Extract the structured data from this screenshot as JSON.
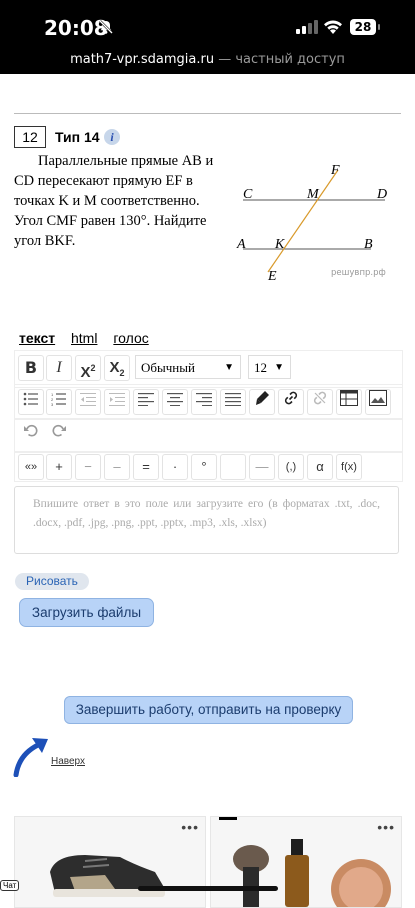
{
  "status_bar": {
    "time": "20:08",
    "battery": "28"
  },
  "address": {
    "domain": "math7-vpr.sdamgia.ru",
    "separator": " — ",
    "access": "частный доступ"
  },
  "task": {
    "number": "12",
    "type_label": "Тип 14",
    "info_icon": "i",
    "text": "Параллельные прямые AB и CD пересекают прямую EF в точках K и M соответственно. Угол CMF равен 130°. Найдите угол BKF.",
    "figure": {
      "labels": {
        "F": "F",
        "C": "C",
        "M": "M",
        "D": "D",
        "A": "A",
        "K": "K",
        "B": "B",
        "E": "E"
      },
      "watermark": "решувпр.рф"
    }
  },
  "editor": {
    "tabs": [
      "текст",
      "html",
      "голос"
    ],
    "active_tab": "текст",
    "format_select": "Обычный",
    "size_select": "12",
    "toolbar_icons": [
      "bold-icon",
      "italic-icon",
      "superscript-icon",
      "subscript-icon",
      "bullet-list-icon",
      "numbered-list-icon",
      "outdent-icon",
      "indent-icon",
      "align-left-icon",
      "align-center-icon",
      "align-right-icon",
      "align-justify-icon",
      "highlight-icon",
      "link-icon",
      "unlink-icon",
      "insert-table-icon",
      "insert-image-icon",
      "undo-icon",
      "redo-icon"
    ],
    "labels": {
      "bold": "B",
      "italic": "I",
      "sup": "X",
      "sub": "X",
      "sup_mark": "2",
      "sub_mark": "2"
    },
    "symbols": [
      "«»",
      "+",
      "−",
      "–",
      "=",
      "·",
      "°",
      "",
      "—",
      "(,)",
      "α",
      "f(x)"
    ],
    "placeholder": "Впишите ответ в это поле или загрузите его (в форматах .txt, .doc, .docx, .pdf, .jpg, .png, .ppt, .pptx, .mp3, .xls, .xlsx)"
  },
  "actions": {
    "draw": "Рисовать",
    "upload": "Загрузить файлы",
    "finish": "Завершить работу, отправить на проверку",
    "to_top": "Наверх"
  },
  "footer": {
    "chat": "Чат",
    "more": "•••"
  }
}
